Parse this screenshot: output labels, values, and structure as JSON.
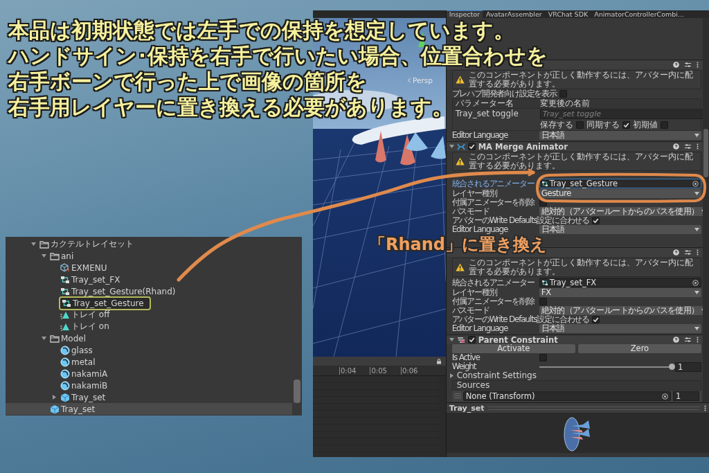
{
  "caption": {
    "lines": [
      "本品は初期状態では左手での保持を想定しています。",
      "ハンドサイン･保持を右手で行いたい場合、位置合わせを",
      "右手ボーンで行った上で画像の箇所を",
      "右手用レイヤーに置き換える必要があります。"
    ]
  },
  "callout": {
    "text": "「Rhand」に置き換え"
  },
  "hierarchy": {
    "items": [
      {
        "label": "カクテルトレイセット",
        "kind": "folder",
        "expanded": true,
        "selected": false,
        "highlighted": false,
        "children": [
          {
            "label": "ani",
            "kind": "folder",
            "expanded": true,
            "selected": false,
            "highlighted": false,
            "children": [
              {
                "label": "EXMENU",
                "kind": "menu",
                "selected": false,
                "highlighted": false
              },
              {
                "label": "Tray_set_FX",
                "kind": "controller",
                "selected": false,
                "highlighted": false
              },
              {
                "label": "Tray_set_Gesture(Rhand)",
                "kind": "controller",
                "selected": false,
                "highlighted": false
              },
              {
                "label": "Tray_set_Gesture",
                "kind": "controller",
                "selected": false,
                "highlighted": true
              },
              {
                "label": "トレイ off",
                "kind": "animation",
                "selected": false,
                "highlighted": false
              },
              {
                "label": "トレイ on",
                "kind": "animation",
                "selected": false,
                "highlighted": false
              }
            ]
          },
          {
            "label": "Model",
            "kind": "folder",
            "expanded": true,
            "selected": false,
            "highlighted": false,
            "children": [
              {
                "label": "glass",
                "kind": "material",
                "selected": false,
                "highlighted": false
              },
              {
                "label": "metal",
                "kind": "material",
                "selected": false,
                "highlighted": false
              },
              {
                "label": "nakamiA",
                "kind": "material",
                "selected": false,
                "highlighted": false
              },
              {
                "label": "nakamiB",
                "kind": "material",
                "selected": false,
                "highlighted": false
              },
              {
                "label": "Tray_set",
                "kind": "prefab",
                "expanded": false,
                "selected": false,
                "highlighted": false
              }
            ]
          },
          {
            "label": "Tray_set",
            "kind": "prefab",
            "selected": true,
            "highlighted": false
          }
        ]
      }
    ]
  },
  "scene": {
    "view_label": "Persp",
    "timeline_ticks": [
      "0:04",
      "0:05",
      "0:06"
    ]
  },
  "inspector": {
    "tabs": [
      {
        "label": "Inspector",
        "selected": true
      },
      {
        "label": "AvatarAssembler",
        "selected": false
      },
      {
        "label": "VRChat SDK",
        "selected": false
      },
      {
        "label": "AnimatorControllerCombi...",
        "selected": false
      }
    ],
    "sections": [
      {
        "rows": [
          {
            "kind": "warning",
            "text": "このコンポーネントが正しく動作するには、アバター内に配置する必要があります。"
          },
          {
            "kind": "check",
            "label": "プレハブ開発者向け設定を表示",
            "checked": false
          },
          {
            "kind": "table-head",
            "columns": [
              "パラメーター名",
              "変更後の名前"
            ]
          },
          {
            "kind": "param",
            "label": "Tray_set toggle",
            "placeholder": "Tray_set toggle",
            "flags": [
              {
                "label": "保存する",
                "checked": false
              },
              {
                "label": "同期する",
                "checked": true
              },
              {
                "label": "初期値",
                "checked": false
              }
            ]
          },
          {
            "kind": "dropdown",
            "label": "Editor Language",
            "value": "日本語"
          }
        ]
      },
      {
        "header": {
          "title": "MA Merge Animator",
          "enabled": true,
          "kind": "modular-avatar"
        },
        "rows": [
          {
            "kind": "warning",
            "text": "このコンポーネントが正しく動作するには、アバター内に配置する必要があります。"
          },
          {
            "kind": "object",
            "label": "統合されるアニメーター",
            "value": "Tray_set_Gesture",
            "focused": true
          },
          {
            "kind": "dropdown",
            "label": "レイヤー種別",
            "value": "Gesture"
          },
          {
            "kind": "check",
            "label": "付属アニメーターを削除",
            "checked": false
          },
          {
            "kind": "dropdown",
            "label": "パスモード",
            "value": "絶対的（アバタールートからのパスを使用）"
          },
          {
            "kind": "check",
            "label": "アバターのWrite Defaults設定に合わせる",
            "checked": true
          },
          {
            "kind": "dropdown",
            "label": "Editor Language",
            "value": "日本語"
          }
        ]
      },
      {
        "rows": [
          {
            "kind": "warning",
            "text": "このコンポーネントが正しく動作するには、アバター内に配置する必要があります。"
          },
          {
            "kind": "object",
            "label": "統合されるアニメーター",
            "value": "Tray_set_FX",
            "focused": false
          },
          {
            "kind": "dropdown",
            "label": "レイヤー種別",
            "value": "FX"
          },
          {
            "kind": "check",
            "label": "付属アニメーターを削除",
            "checked": false
          },
          {
            "kind": "dropdown",
            "label": "パスモード",
            "value": "絶対的（アバタールートからのパスを使用）"
          },
          {
            "kind": "check",
            "label": "アバターのWrite Defaults設定に合わせる",
            "checked": true
          },
          {
            "kind": "dropdown",
            "label": "Editor Language",
            "value": "日本語"
          }
        ]
      },
      {
        "header": {
          "title": "Parent Constraint",
          "enabled": true,
          "kind": "constraint"
        },
        "rows": [
          {
            "kind": "buttons",
            "labels": [
              "Activate",
              "Zero"
            ]
          },
          {
            "kind": "check",
            "label": "Is Active",
            "checked": false
          },
          {
            "kind": "slider",
            "label": "Weight",
            "level": 1,
            "value": "1"
          },
          {
            "kind": "foldout",
            "label": "Constraint Settings",
            "expanded": false
          },
          {
            "kind": "list-head",
            "label": "Sources"
          },
          {
            "kind": "source",
            "value": "None (Transform)",
            "weight": "1"
          }
        ]
      }
    ],
    "preview": {
      "title": "Tray_set"
    }
  }
}
